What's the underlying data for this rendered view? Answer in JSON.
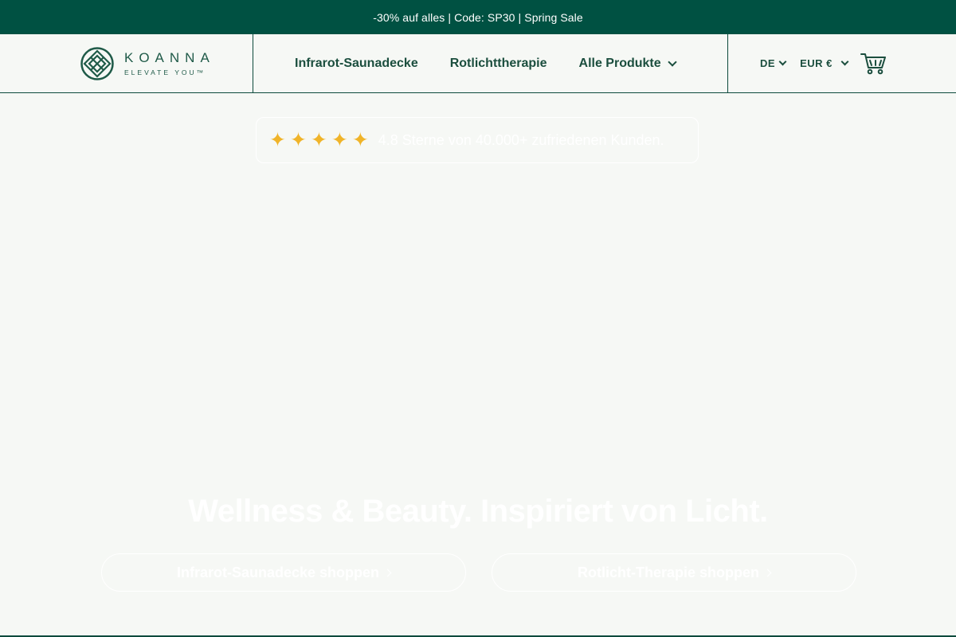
{
  "promo": {
    "text": "-30% auf alles | Code: SP30 | Spring Sale"
  },
  "logo": {
    "wordmark": "KOANNA",
    "tagline": "ELEVATE YOU™"
  },
  "nav": {
    "items": [
      {
        "label": "Infrarot-Saunadecke"
      },
      {
        "label": "Rotlichttherapie"
      },
      {
        "label": "Alle Produkte"
      }
    ]
  },
  "util": {
    "language": "DE",
    "currency": "EUR €"
  },
  "rating": {
    "stars": 5,
    "text": "4.8 Sterne von 40.000+ zufriedenen Kunden."
  },
  "hero": {
    "title": "Wellness & Beauty. Inspiriert von Licht.",
    "cta_left": "Infrarot-Saunadecke shoppen",
    "cta_right": "Rotlicht-Therapie shoppen"
  },
  "colors": {
    "brand_green": "#005142",
    "star": "#f0b429"
  }
}
